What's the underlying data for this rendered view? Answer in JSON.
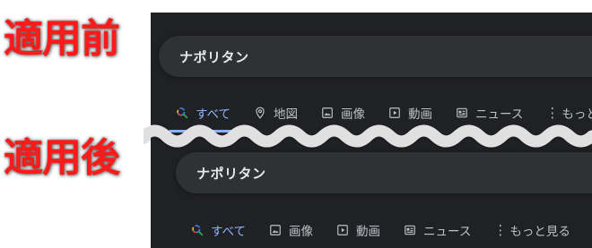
{
  "labels": {
    "before": "適用前",
    "after": "適用後"
  },
  "before": {
    "query": "ナポリタン",
    "tabs": [
      {
        "label": "すべて",
        "icon": "search-icon",
        "active": true
      },
      {
        "label": "地図",
        "icon": "map-pin-icon"
      },
      {
        "label": "画像",
        "icon": "image-icon"
      },
      {
        "label": "動画",
        "icon": "play-icon"
      },
      {
        "label": "ニュース",
        "icon": "news-icon"
      },
      {
        "label": "もっと見",
        "icon": "more-vert-icon"
      }
    ]
  },
  "after": {
    "query": "ナポリタン",
    "tabs": [
      {
        "label": "すべて",
        "icon": "search-icon",
        "active": true
      },
      {
        "label": "画像",
        "icon": "image-icon"
      },
      {
        "label": "動画",
        "icon": "play-icon"
      },
      {
        "label": "ニュース",
        "icon": "news-icon"
      },
      {
        "label": "もっと見る",
        "icon": "more-vert-icon"
      }
    ]
  },
  "colors": {
    "panel_bg": "#202124",
    "searchbox_bg": "#303134",
    "active_tab": "#8ab4f8",
    "label_red": "#ff1a1a"
  }
}
